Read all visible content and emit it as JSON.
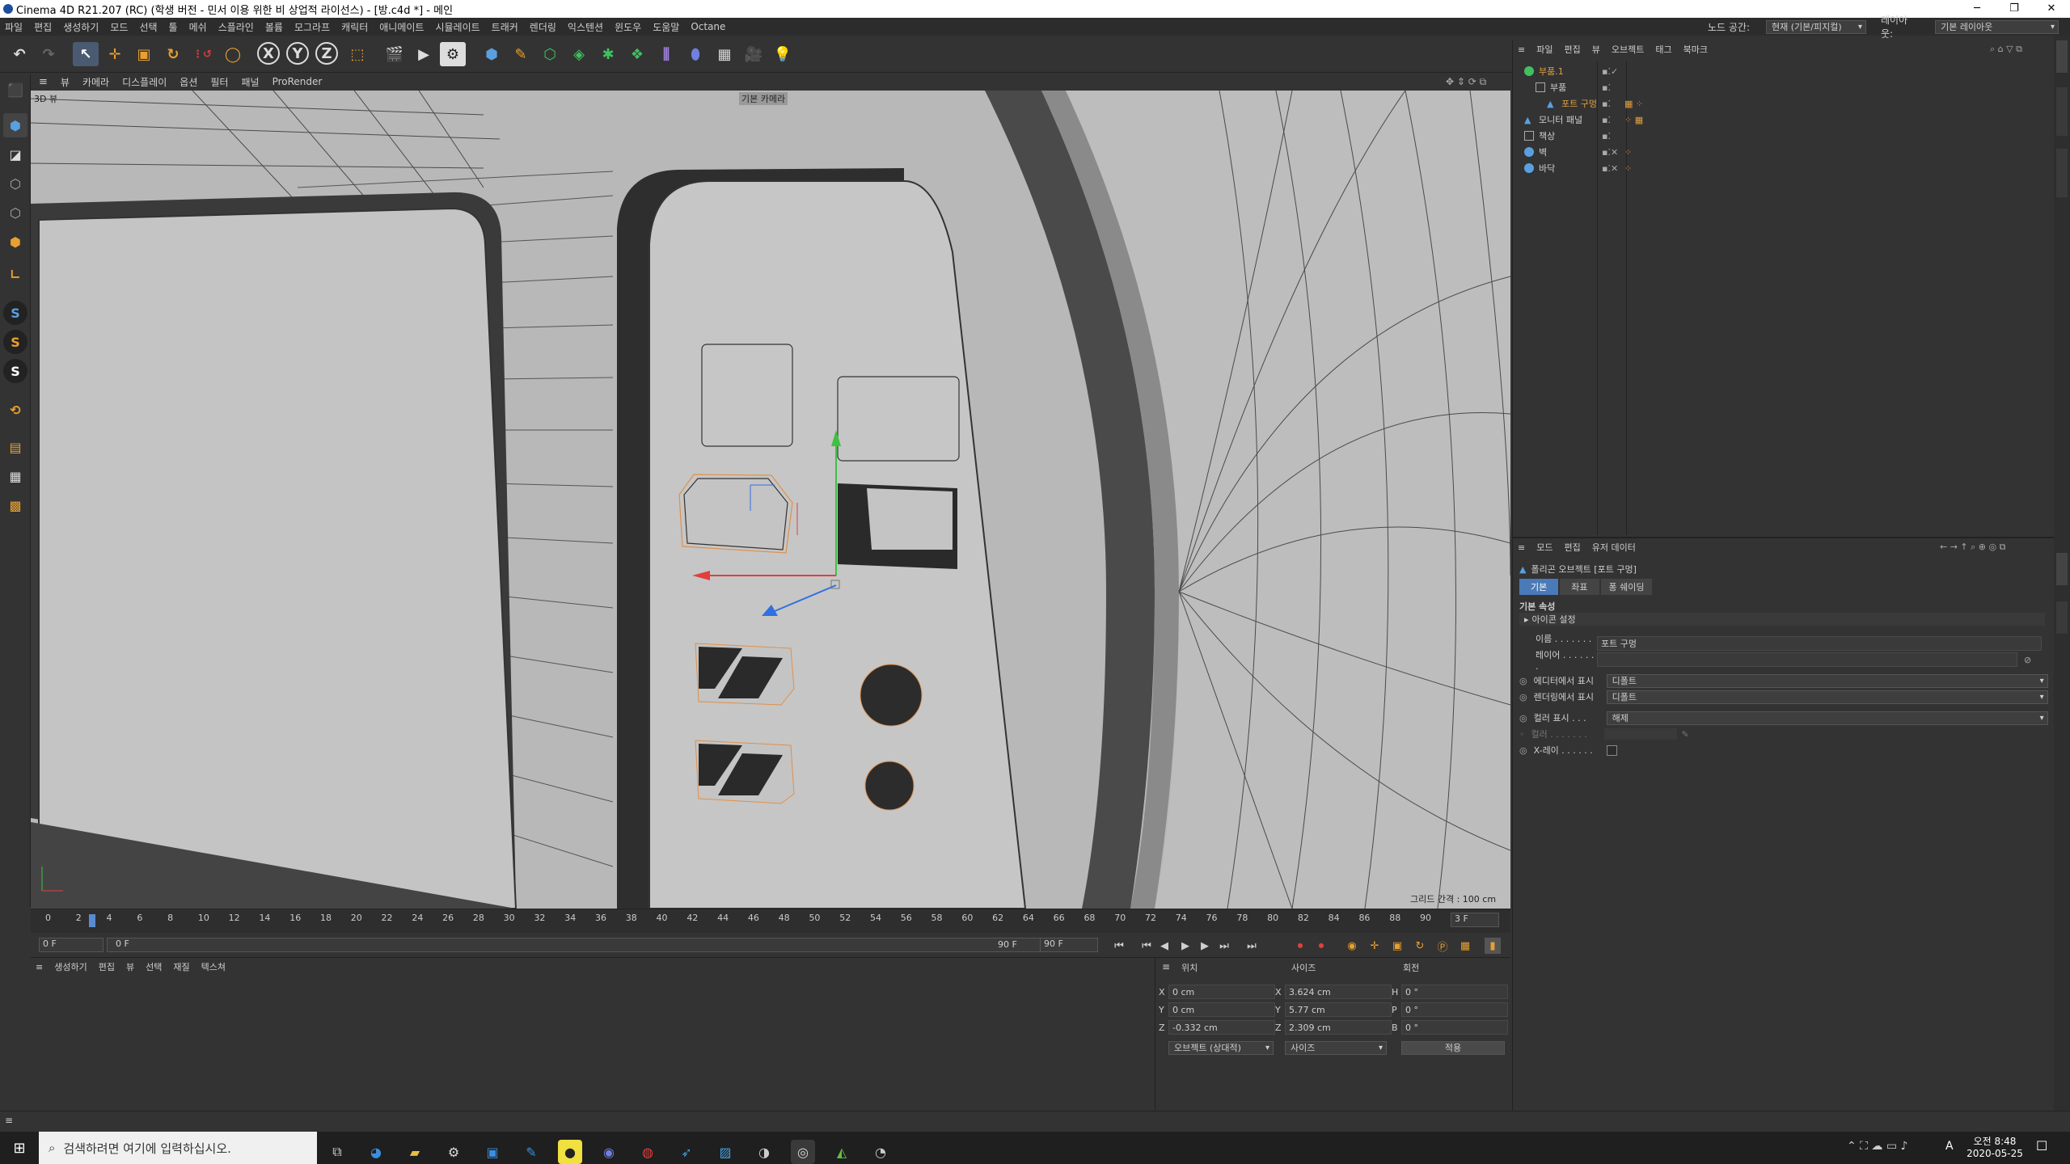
{
  "title": "Cinema 4D R21.207 (RC) (학생 버전 - 민서 이용 위한 비 상업적 라이선스) - [방.c4d *] - 메인",
  "menu": [
    "파일",
    "편집",
    "생성하기",
    "모드",
    "선택",
    "툴",
    "메쉬",
    "스플라인",
    "볼륨",
    "모그라프",
    "캐릭터",
    "애니메이트",
    "시뮬레이트",
    "트래커",
    "렌더링",
    "익스텐션",
    "윈도우",
    "도움말",
    "Octane"
  ],
  "node_space_label": "노드 공간:",
  "node_space_value": "현재 (기본/피지컬)",
  "layout_label": "레이아웃:",
  "layout_value": "기본 레이아웃",
  "viewport": {
    "menu": [
      "뷰",
      "카메라",
      "디스플레이",
      "옵션",
      "필터",
      "패널",
      "ProRender"
    ],
    "label_3d": "3D 뷰",
    "camera_label": "기본 카메라",
    "grid_label": "그리드 간격 : 100 cm"
  },
  "objects_panel": {
    "menu": [
      "파일",
      "편집",
      "뷰",
      "오브젝트",
      "태그",
      "북마크"
    ],
    "items": [
      {
        "name": "부품.1",
        "indent": 0,
        "color": "#e0a040"
      },
      {
        "name": "부품",
        "indent": 1,
        "color": "#cfcfcf"
      },
      {
        "name": "포트 구멍",
        "indent": 2,
        "color": "#e0a040"
      },
      {
        "name": "모니터 패널",
        "indent": 0,
        "color": "#cfcfcf"
      },
      {
        "name": "책상",
        "indent": 0,
        "color": "#cfcfcf"
      },
      {
        "name": "벽",
        "indent": 0,
        "color": "#cfcfcf"
      },
      {
        "name": "바닥",
        "indent": 0,
        "color": "#cfcfcf"
      }
    ]
  },
  "attributes": {
    "menu": [
      "모드",
      "편집",
      "유저 데이터"
    ],
    "object_title": "폴리곤 오브젝트 [포트 구멍]",
    "tabs": [
      "기본",
      "좌표",
      "퐁 쉐이딩"
    ],
    "section": "기본 속성",
    "subsection": "아이콘 설정",
    "name_label": "이름 . . . . . . . .",
    "name_value": "포트 구멍",
    "layer_label": "레이어 . . . . . . .",
    "editor_label": "에디터에서 표시",
    "editor_value": "디폴트",
    "render_label": "렌더링에서 표시",
    "render_value": "디폴트",
    "color_show_label": "컬러 표시 . . .",
    "color_show_value": "해제",
    "color_label": "컬러 . . . . . . .",
    "xray_label": "X-레이 . . . . . ."
  },
  "timeline": {
    "ticks": [
      "0",
      "2",
      "4",
      "6",
      "8",
      "10",
      "12",
      "14",
      "16",
      "18",
      "20",
      "22",
      "24",
      "26",
      "28",
      "30",
      "32",
      "34",
      "36",
      "38",
      "40",
      "42",
      "44",
      "46",
      "48",
      "50",
      "52",
      "54",
      "56",
      "58",
      "60",
      "62",
      "64",
      "66",
      "68",
      "70",
      "72",
      "74",
      "76",
      "78",
      "80",
      "82",
      "84",
      "86",
      "88",
      "90"
    ],
    "current_marker": "3",
    "end_field": "3 F"
  },
  "transport": {
    "start": "0 F",
    "current": "0 F",
    "end": "90 F",
    "max": "90 F"
  },
  "material": {
    "menu": [
      "생성하기",
      "편집",
      "뷰",
      "선택",
      "재질",
      "텍스쳐"
    ]
  },
  "coords": {
    "headers": [
      "위치",
      "사이즈",
      "회전"
    ],
    "pos": [
      {
        "axis": "X",
        "value": "0 cm"
      },
      {
        "axis": "Y",
        "value": "0 cm"
      },
      {
        "axis": "Z",
        "value": "-0.332 cm"
      }
    ],
    "size": [
      {
        "axis": "X",
        "value": "3.624 cm"
      },
      {
        "axis": "Y",
        "value": "5.77 cm"
      },
      {
        "axis": "Z",
        "value": "2.309 cm"
      }
    ],
    "rot": [
      {
        "axis": "H",
        "value": "0 °"
      },
      {
        "axis": "P",
        "value": "0 °"
      },
      {
        "axis": "B",
        "value": "0 °"
      }
    ],
    "mode_value": "오브젝트 (상대적)",
    "size_mode_value": "사이즈",
    "apply_label": "적용"
  },
  "taskbar": {
    "search_placeholder": "검색하려면 여기에 입력하십시오.",
    "time": "오전 8:48",
    "date": "2020-05-25",
    "ime": "A"
  }
}
